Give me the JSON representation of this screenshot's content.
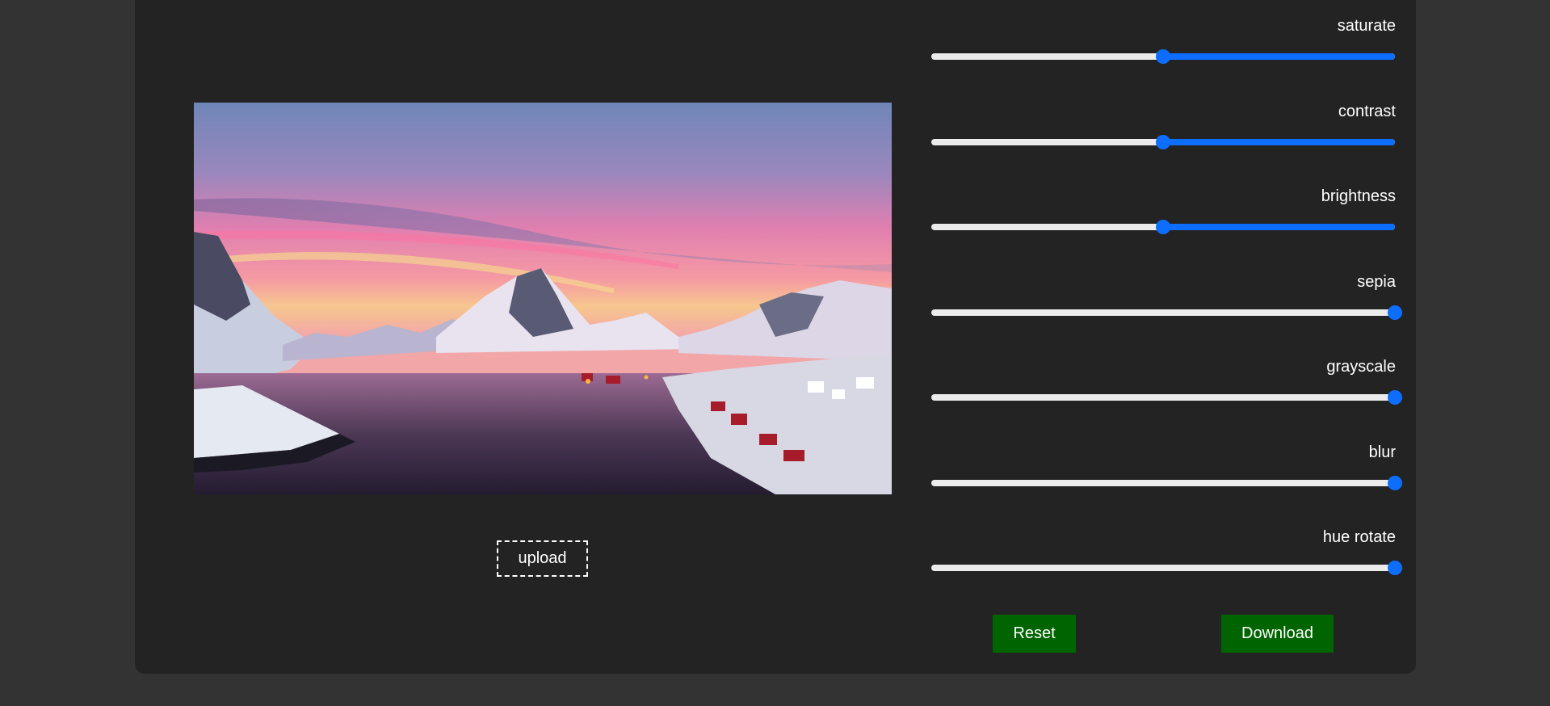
{
  "editor": {
    "upload_label": "upload",
    "sliders": [
      {
        "label": "saturate",
        "value": 0.5
      },
      {
        "label": "contrast",
        "value": 0.5
      },
      {
        "label": "brightness",
        "value": 0.5
      },
      {
        "label": "sepia",
        "value": 1.0
      },
      {
        "label": "grayscale",
        "value": 1.0
      },
      {
        "label": "blur",
        "value": 1.0
      },
      {
        "label": "hue rotate",
        "value": 1.0
      }
    ],
    "reset_label": "Reset",
    "download_label": "Download"
  },
  "colors": {
    "page_background": "#333333",
    "panel_background": "#232323",
    "slider_accent": "#0d6efd",
    "slider_track": "#ececec",
    "button_green": "#006400"
  }
}
